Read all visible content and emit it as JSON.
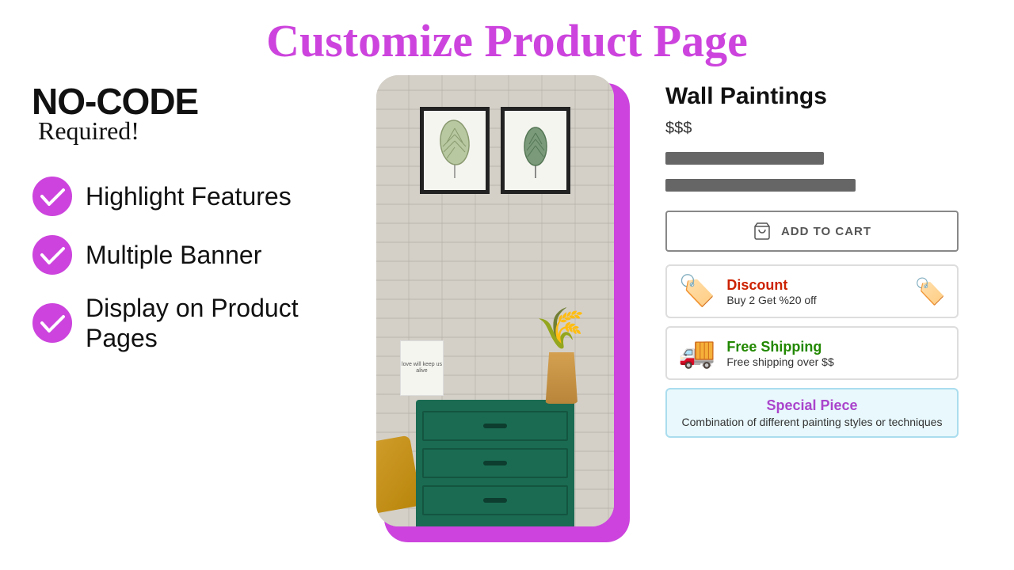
{
  "header": {
    "title": "Customize Product Page"
  },
  "left": {
    "no_code": "NO-CODE",
    "required": "Required!",
    "features": [
      {
        "label": "Highlight Features"
      },
      {
        "label": "Multiple Banner"
      },
      {
        "label": "Display on Product Pages"
      }
    ]
  },
  "product": {
    "name": "Wall Paintings",
    "price": "$$$",
    "add_to_cart": "ADD TO CART"
  },
  "promos": [
    {
      "id": "discount",
      "title": "Discount",
      "desc": "Buy 2 Get %20 off"
    },
    {
      "id": "shipping",
      "title": "Free Shipping",
      "desc": "Free shipping over $$"
    }
  ],
  "special": {
    "title": "Special Piece",
    "desc": "Combination of different painting styles or techniques"
  }
}
